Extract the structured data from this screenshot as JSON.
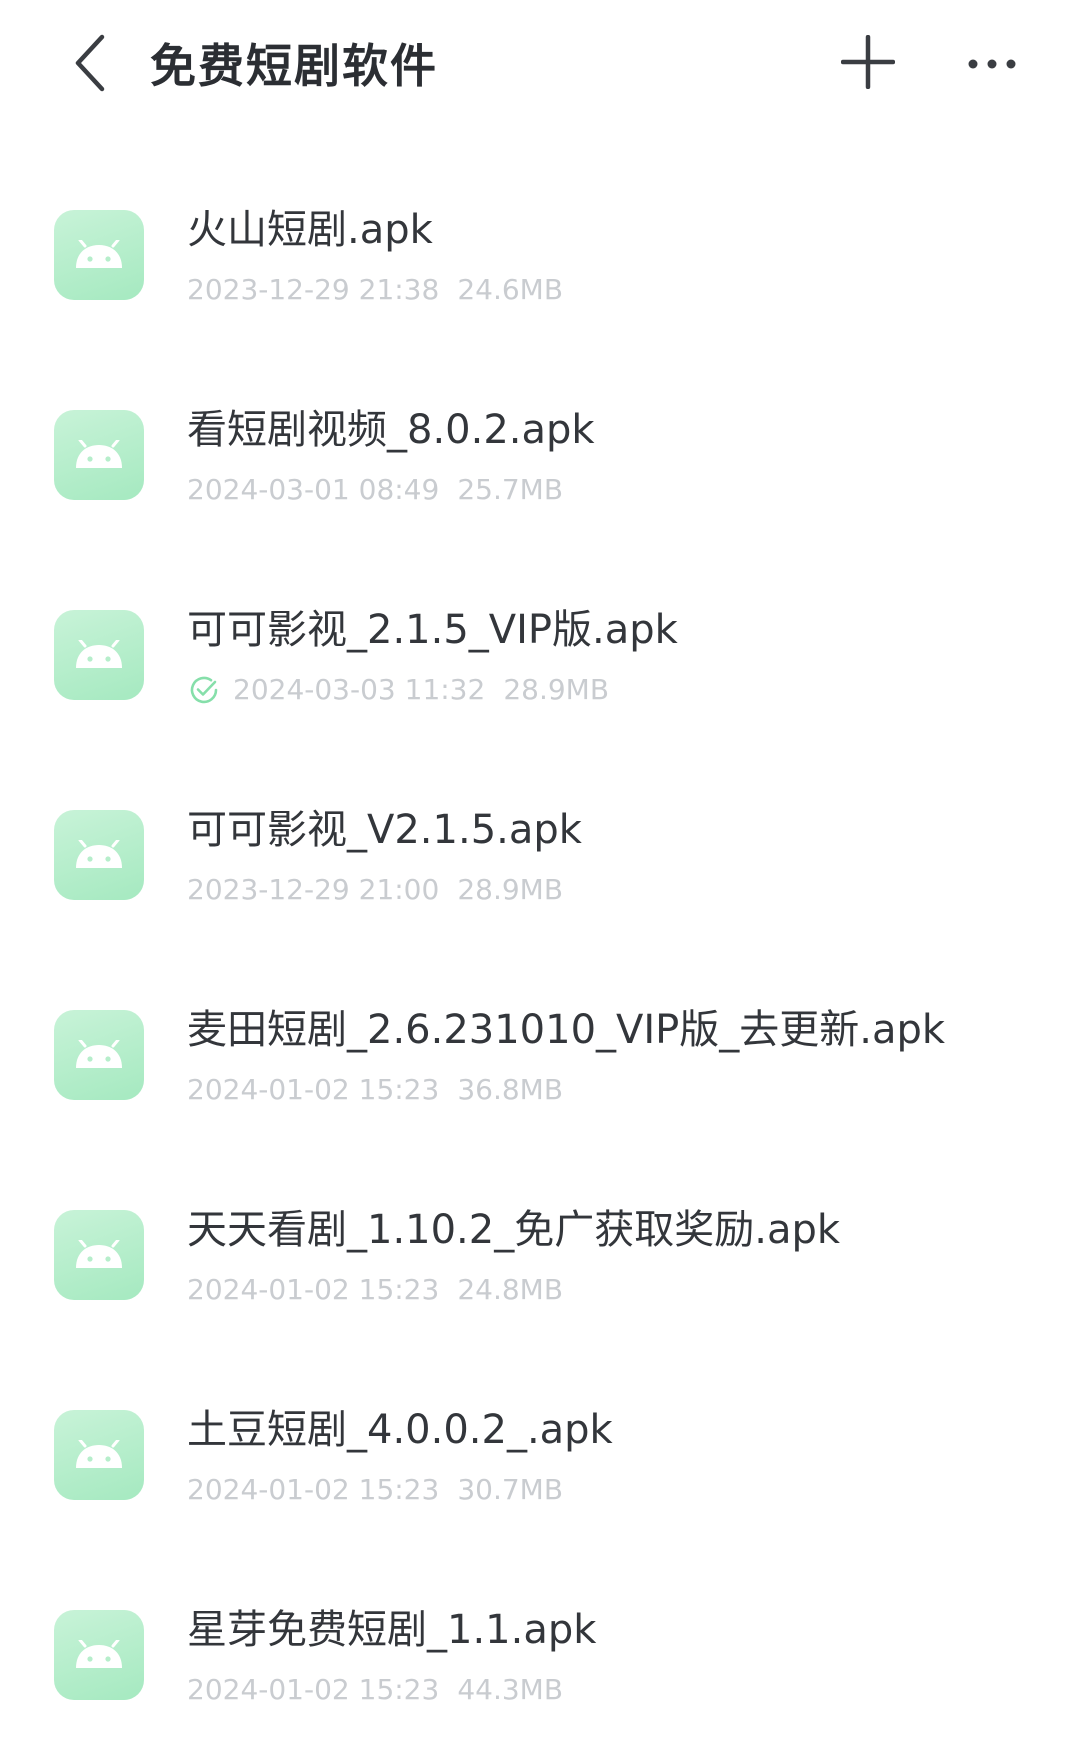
{
  "header": {
    "title": "免费短剧软件",
    "back_icon": "chevron-left-icon",
    "add_icon": "plus-icon",
    "more_icon": "more-horizontal-icon"
  },
  "colors": {
    "icon_bg": "#b6eecb",
    "icon_fg": "#ffffff",
    "check": "#86dfaa",
    "meta_text": "#c9ccd0"
  },
  "files": [
    {
      "name": "火山短剧.apk",
      "date": "2023-12-29 21:38",
      "size": "24.6MB",
      "installed": false,
      "icon": "android-icon"
    },
    {
      "name": "看短剧视频_8.0.2.apk",
      "date": "2024-03-01 08:49",
      "size": "25.7MB",
      "installed": false,
      "icon": "android-icon"
    },
    {
      "name": "可可影视_2.1.5_VIP版.apk",
      "date": "2024-03-03 11:32",
      "size": "28.9MB",
      "installed": true,
      "icon": "android-icon"
    },
    {
      "name": "可可影视_V2.1.5.apk",
      "date": "2023-12-29 21:00",
      "size": "28.9MB",
      "installed": false,
      "icon": "android-icon"
    },
    {
      "name": "麦田短剧_2.6.231010_VIP版_去更新.apk",
      "date": "2024-01-02 15:23",
      "size": "36.8MB",
      "installed": false,
      "icon": "android-icon"
    },
    {
      "name": "天天看剧_1.10.2_免广获取奖励.apk",
      "date": "2024-01-02 15:23",
      "size": "24.8MB",
      "installed": false,
      "icon": "android-icon"
    },
    {
      "name": "土豆短剧_4.0.0.2_.apk",
      "date": "2024-01-02 15:23",
      "size": "30.7MB",
      "installed": false,
      "icon": "android-icon"
    },
    {
      "name": "星芽免费短剧_1.1.apk",
      "date": "2024-01-02 15:23",
      "size": "44.3MB",
      "installed": false,
      "icon": "android-icon"
    }
  ]
}
